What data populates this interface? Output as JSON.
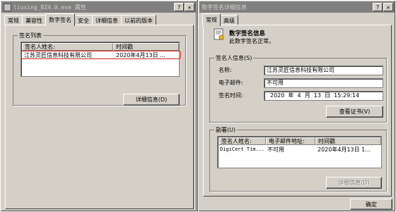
{
  "left": {
    "title": "liuxing_BZ4.0.exe 属性",
    "tabs": [
      "常规",
      "兼容性",
      "数字签名",
      "安全",
      "详细信息",
      "以前的版本"
    ],
    "group_label": "签名列表",
    "columns": [
      "签名人姓名:",
      "时间戳"
    ],
    "rows": [
      {
        "name": "江苏灵匠信息科技有限公司",
        "time": "2020年4月13日 ..."
      }
    ],
    "details_button": "详细信息(D)",
    "highlight_color": "#e02020"
  },
  "right": {
    "title": "数字签名详细信息",
    "tabs": [
      "常规",
      "高级"
    ],
    "info_title": "数字签名信息",
    "info_status": "此数字签名正常。",
    "signer_group_label": "签名人信息(S)",
    "name_label": "名称:",
    "name_value": "江苏灵匠信息科技有限公司",
    "email_label": "电子邮件:",
    "email_value": "不可用",
    "time_label": "签名时间:",
    "time_value": "2020  年  4  月  13  日  15:29:14",
    "view_cert_button": "查看证书(V)",
    "counter_group_label": "副署(U)",
    "counter_columns": [
      "签名人姓名:",
      "电子邮件地址:",
      "时间戳"
    ],
    "counter_rows": [
      {
        "name": "DigiCert Tim...",
        "email": "不可用",
        "time": "2020年4月13日 1..."
      }
    ],
    "counter_details_button": "详细信息(D)",
    "ok_button": "确定"
  }
}
